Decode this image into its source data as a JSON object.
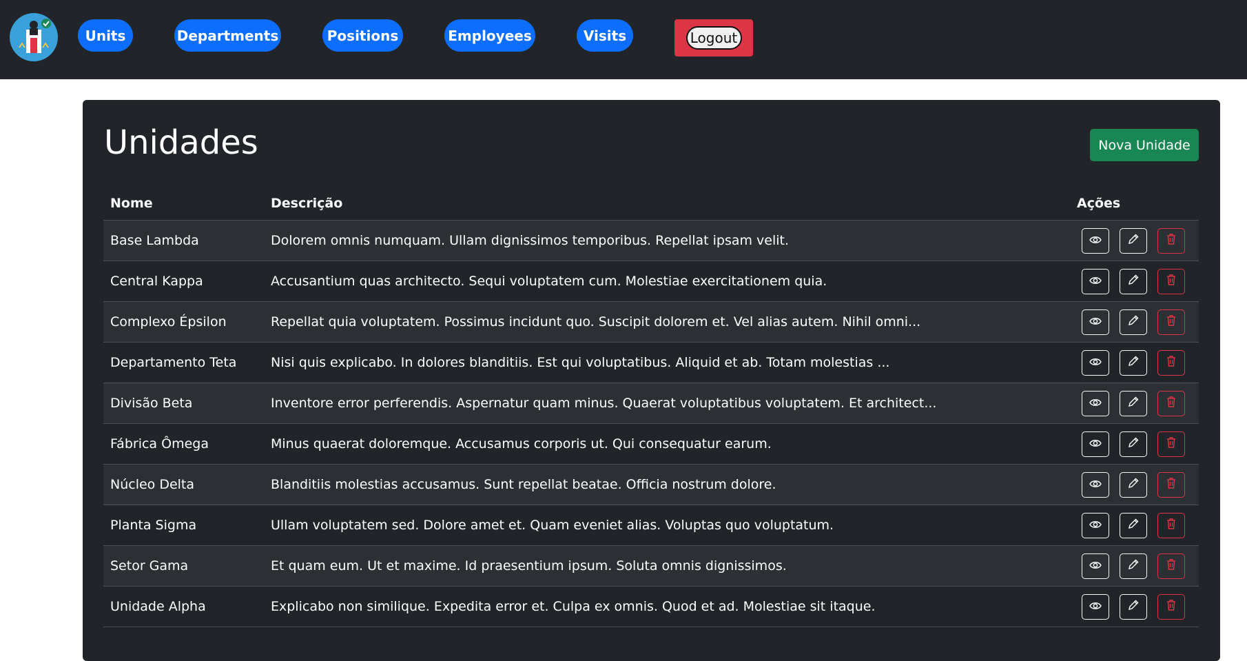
{
  "nav": {
    "items": [
      {
        "label": "Units"
      },
      {
        "label": "Departments"
      },
      {
        "label": "Positions"
      },
      {
        "label": "Employees"
      },
      {
        "label": "Visits"
      }
    ],
    "logout_label": "Logout"
  },
  "page": {
    "title": "Unidades",
    "new_button_label": "Nova Unidade"
  },
  "table": {
    "headers": {
      "name": "Nome",
      "description": "Descrição",
      "actions": "Ações"
    },
    "rows": [
      {
        "name": "Base Lambda",
        "description": "Dolorem omnis numquam. Ullam dignissimos temporibus. Repellat ipsam velit."
      },
      {
        "name": "Central Kappa",
        "description": "Accusantium quas architecto. Sequi voluptatem cum. Molestiae exercitationem quia."
      },
      {
        "name": "Complexo Épsilon",
        "description": "Repellat quia voluptatem. Possimus incidunt quo. Suscipit dolorem et. Vel alias autem. Nihil omni..."
      },
      {
        "name": "Departamento Teta",
        "description": "Nisi quis explicabo. In dolores blanditiis. Est qui voluptatibus. Aliquid et ab. Totam molestias ..."
      },
      {
        "name": "Divisão Beta",
        "description": "Inventore error perferendis. Aspernatur quam minus. Quaerat voluptatibus voluptatem. Et architect..."
      },
      {
        "name": "Fábrica Ômega",
        "description": "Minus quaerat doloremque. Accusamus corporis ut. Qui consequatur earum."
      },
      {
        "name": "Núcleo Delta",
        "description": "Blanditiis molestias accusamus. Sunt repellat beatae. Officia nostrum dolore."
      },
      {
        "name": "Planta Sigma",
        "description": "Ullam voluptatem sed. Dolore amet et. Quam eveniet alias. Voluptas quo voluptatum."
      },
      {
        "name": "Setor Gama",
        "description": "Et quam eum. Ut et maxime. Id praesentium ipsum. Soluta omnis dignissimos."
      },
      {
        "name": "Unidade Alpha",
        "description": "Explicabo non similique. Expedita error et. Culpa ex omnis. Quod et ad. Molestiae sit itaque."
      }
    ]
  },
  "colors": {
    "nav_pill": "#0d6efd",
    "logout": "#dc3545",
    "new_button": "#198754",
    "card": "#212529",
    "danger": "#dc3545"
  },
  "icons": {
    "view": "eye-icon",
    "edit": "pencil-icon",
    "delete": "trash-icon"
  }
}
